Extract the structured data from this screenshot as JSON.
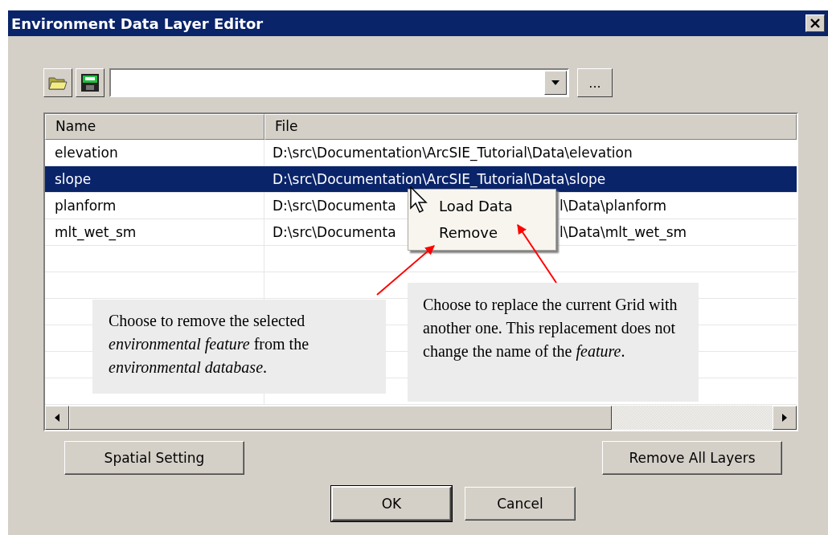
{
  "window": {
    "title": "Environment Data Layer Editor"
  },
  "toolbar": {
    "browse_button": "..."
  },
  "table": {
    "columns": [
      "Name",
      "File"
    ],
    "rows": [
      {
        "name": "elevation",
        "file": "D:\\src\\Documentation\\ArcSIE_Tutorial\\Data\\elevation",
        "selected": false
      },
      {
        "name": "slope",
        "file": "D:\\src\\Documentation\\ArcSIE_Tutorial\\Data\\slope",
        "selected": true
      },
      {
        "name": "planform",
        "file": "D:\\src\\Documenta",
        "file_end": "l\\Data\\planform",
        "selected": false
      },
      {
        "name": "mlt_wet_sm",
        "file": "D:\\src\\Documenta",
        "file_end": "l\\Data\\mlt_wet_sm",
        "selected": false
      }
    ]
  },
  "context_menu": {
    "items": [
      "Load Data",
      "Remove"
    ]
  },
  "callouts": [
    {
      "text": "Choose to remove the selected *environmental feature* from the *environmental database*."
    },
    {
      "text": "Choose to replace the current Grid with another one. This replacement does not change the name of the *feature*."
    }
  ],
  "buttons": {
    "left": "Spatial Setting",
    "right": "Remove All Layers",
    "ok": "OK",
    "cancel": "Cancel"
  }
}
